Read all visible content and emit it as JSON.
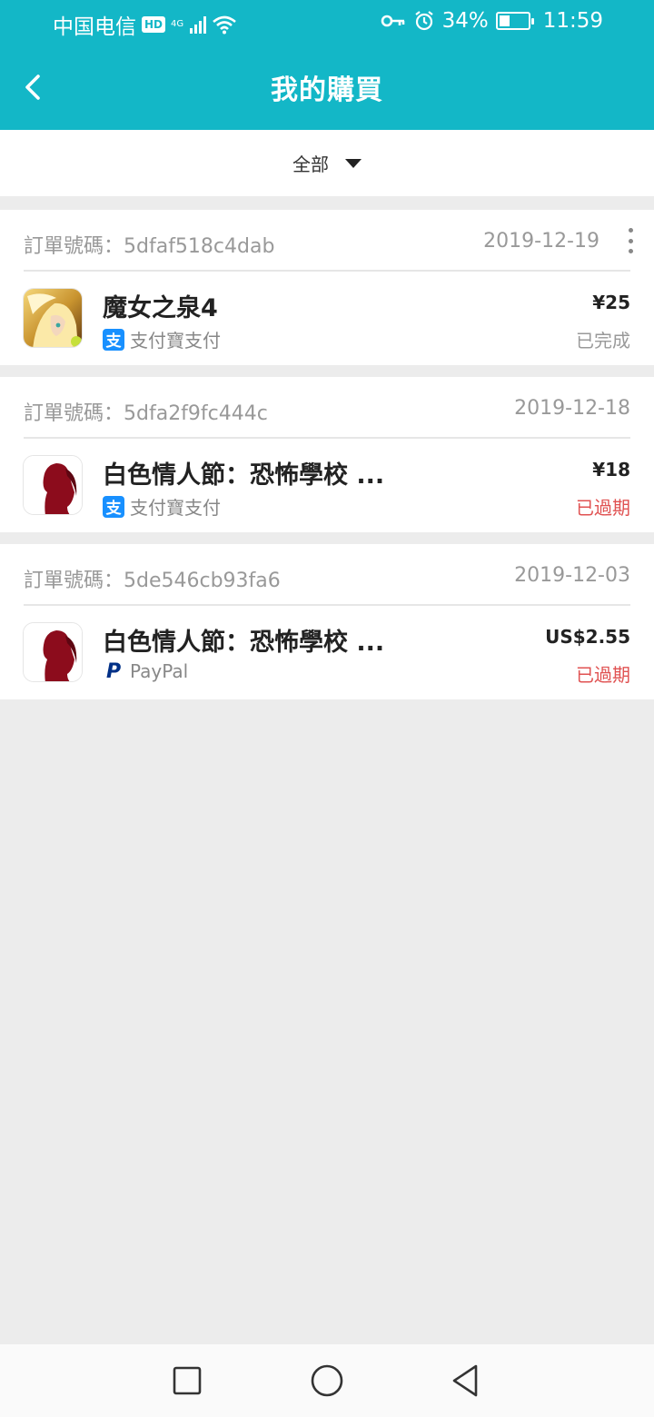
{
  "status_bar": {
    "carrier": "中国电信",
    "hd": "HD",
    "network": "4G",
    "battery": "34%",
    "battery_level": 0.34,
    "time": "11:59"
  },
  "header": {
    "title": "我的購買",
    "back_icon": "chevron-left-icon"
  },
  "filter": {
    "label": "全部",
    "icon": "caret-down-icon"
  },
  "orders": [
    {
      "order_no": "訂單號碼：5dfaf518c4dab",
      "date": "2019-12-19",
      "game_name": "魔女之泉4",
      "payment": "支付寶支付",
      "payment_icon": "alipay-icon",
      "price": "¥25",
      "status": "已完成",
      "status_color": "#999999"
    },
    {
      "order_no": "訂單號碼：5dfa2f9fc444c",
      "date": "2019-12-18",
      "game_name": "白色情人節：恐怖學校 ...",
      "payment": "支付寶支付",
      "payment_icon": "alipay-icon",
      "price": "¥18",
      "status": "已過期",
      "status_color": "#e05252"
    },
    {
      "order_no": "訂單號碼：5de546cb93fa6",
      "date": "2019-12-03",
      "game_name": "白色情人節：恐怖學校 ...",
      "payment": "PayPal",
      "payment_icon": "paypal-icon",
      "price": "US$2.55",
      "status": "已過期",
      "status_color": "#e05252"
    }
  ],
  "colors": {
    "accent": "#13b7c7",
    "background": "#ececec"
  }
}
